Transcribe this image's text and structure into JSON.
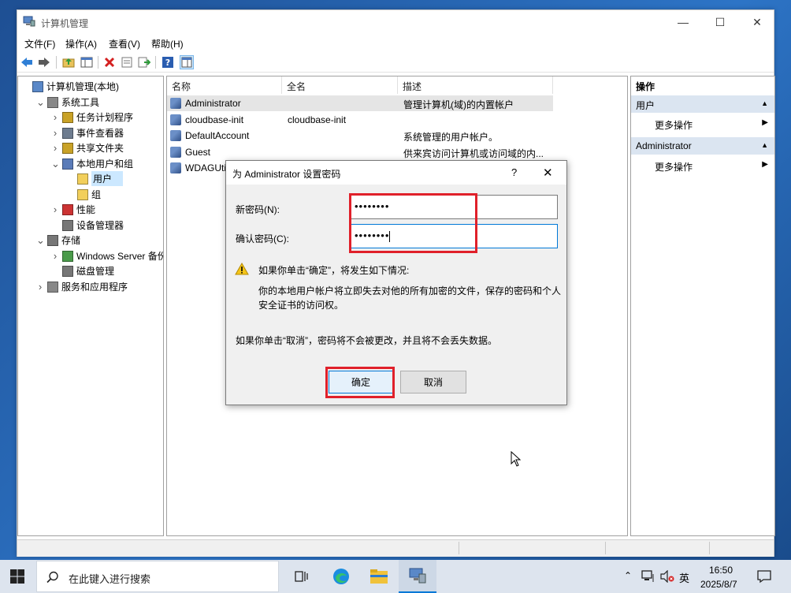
{
  "window": {
    "title": "计算机管理",
    "controls": [
      "—",
      "☐",
      "✕"
    ]
  },
  "menu": [
    "文件(F)",
    "操作(A)",
    "查看(V)",
    "帮助(H)"
  ],
  "toolbar_icons": [
    "back-arrow-icon",
    "forward-arrow-icon",
    "up-folder-icon",
    "show-hide-tree-icon",
    "delete-icon",
    "properties-icon",
    "export-list-icon",
    "help-icon",
    "show-hide-action-pane-icon"
  ],
  "tree": [
    {
      "label": "计算机管理(本地)",
      "level": 0,
      "expander": ""
    },
    {
      "label": "系统工具",
      "level": 1,
      "expander": "v"
    },
    {
      "label": "任务计划程序",
      "level": 2,
      "expander": ">"
    },
    {
      "label": "事件查看器",
      "level": 2,
      "expander": ">"
    },
    {
      "label": "共享文件夹",
      "level": 2,
      "expander": ">"
    },
    {
      "label": "本地用户和组",
      "level": 2,
      "expander": "v"
    },
    {
      "label": "用户",
      "level": 3,
      "expander": "",
      "selected": true
    },
    {
      "label": "组",
      "level": 3,
      "expander": ""
    },
    {
      "label": "性能",
      "level": 2,
      "expander": ">"
    },
    {
      "label": "设备管理器",
      "level": 2,
      "expander": ""
    },
    {
      "label": "存储",
      "level": 1,
      "expander": "v"
    },
    {
      "label": "Windows Server 备份",
      "level": 2,
      "expander": ">"
    },
    {
      "label": "磁盘管理",
      "level": 2,
      "expander": ""
    },
    {
      "label": "服务和应用程序",
      "level": 1,
      "expander": ">"
    }
  ],
  "list": {
    "columns": [
      "名称",
      "全名",
      "描述"
    ],
    "rows": [
      {
        "name": "Administrator",
        "fullname": "",
        "desc": "管理计算机(域)的内置帐户",
        "selected": true
      },
      {
        "name": "cloudbase-init",
        "fullname": "cloudbase-init",
        "desc": ""
      },
      {
        "name": "DefaultAccount",
        "fullname": "",
        "desc": "系统管理的用户帐户。"
      },
      {
        "name": "Guest",
        "fullname": "",
        "desc": "供来宾访问计算机或访问域的内..."
      },
      {
        "name": "WDAGUti",
        "fullname": "",
        "desc": ""
      }
    ]
  },
  "actions": {
    "header": "操作",
    "sections": [
      {
        "title": "用户",
        "item": "更多操作"
      },
      {
        "title": "Administrator",
        "item": "更多操作"
      }
    ]
  },
  "dialog": {
    "title": "为 Administrator 设置密码",
    "help": "?",
    "close": "✕",
    "new_pw_label": "新密码(N):",
    "new_pw_value": "••••••••",
    "confirm_pw_label": "确认密码(C):",
    "confirm_pw_value": "••••••••",
    "warn_title": "如果你单击“确定”，将发生如下情况:",
    "warn_body": "你的本地用户帐户将立即失去对他的所有加密的文件，保存的密码和个人安全证书的访问权。",
    "cancel_note": "如果你单击“取消”，密码将不会被更改，并且将不会丢失数据。",
    "ok": "确定",
    "cancel": "取消"
  },
  "taskbar": {
    "search_placeholder": "在此键入进行搜索",
    "ime": "英",
    "time": "16:50",
    "date": "2025/8/7"
  },
  "colors": {
    "selection": "#cce8ff",
    "accent": "#0078d7",
    "highlight": "#e0202a"
  }
}
